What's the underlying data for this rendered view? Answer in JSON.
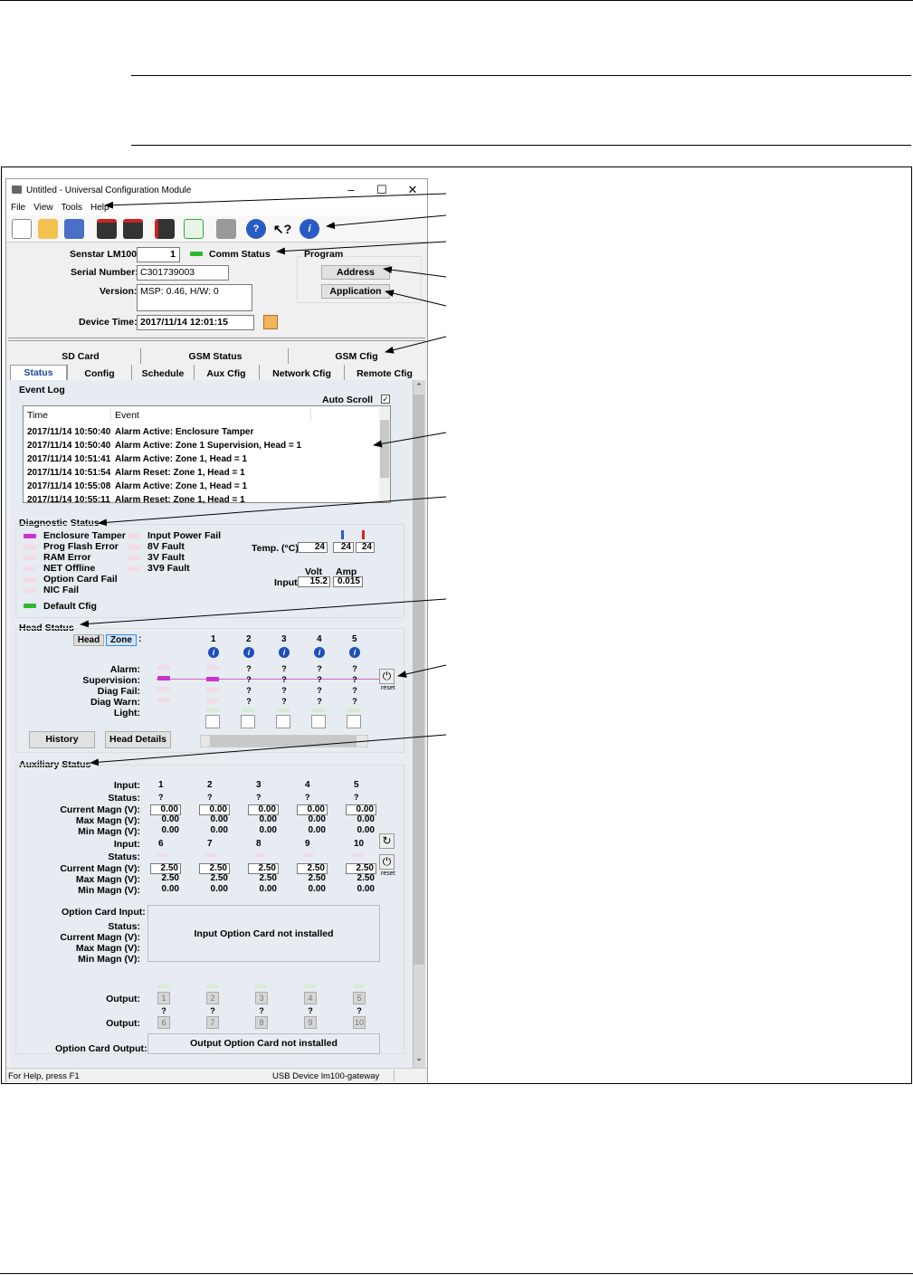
{
  "app": {
    "title": "Untitled - Universal Configuration Module",
    "window_controls": [
      "–",
      "☐",
      "✕"
    ],
    "menu": [
      "File",
      "View",
      "Tools",
      "Help"
    ]
  },
  "toolbar_icons": [
    "new-file-icon",
    "open-folder-icon",
    "save-icon",
    "download-icon",
    "upload-icon",
    "device-icon",
    "waveform-icon",
    "print-icon",
    "help-icon",
    "context-help-icon",
    "info-icon"
  ],
  "device": {
    "model_label": "Senstar LM100:",
    "model_value": "1",
    "comm_status": "Comm Status",
    "serial_label": "Serial Number:",
    "serial_value": "C301739003",
    "version_label": "Version:",
    "version_value": "MSP: 0.46, H/W: 0",
    "time_label": "Device Time:",
    "time_value": "2017/11/14 12:01:15"
  },
  "program": {
    "label": "Program",
    "address_button": "Address",
    "application_button": "Application"
  },
  "tabs_row1": [
    "SD Card",
    "GSM Status",
    "GSM Cfig"
  ],
  "tabs_row2": [
    "Status",
    "Config",
    "Schedule",
    "Aux Cfig",
    "Network Cfig",
    "Remote Cfig"
  ],
  "event_log": {
    "title": "Event Log",
    "auto_scroll": "Auto Scroll",
    "columns": [
      "Time",
      "Event"
    ],
    "rows": [
      [
        "2017/11/14 10:50:40",
        "Alarm Active: Enclosure Tamper"
      ],
      [
        "2017/11/14 10:50:40",
        "Alarm Active: Zone 1 Supervision, Head = 1"
      ],
      [
        "2017/11/14 10:51:41",
        "Alarm Active: Zone 1, Head = 1"
      ],
      [
        "2017/11/14 10:51:54",
        "Alarm Reset: Zone 1, Head = 1"
      ],
      [
        "2017/11/14 10:55:08",
        "Alarm Active: Zone 1, Head = 1"
      ],
      [
        "2017/11/14 10:55:11",
        "Alarm Reset: Zone 1, Head = 1"
      ]
    ]
  },
  "diagnostic": {
    "title": "Diagnostic Status",
    "left": [
      "Enclosure Tamper",
      "Prog Flash Error",
      "RAM Error",
      "NET Offline",
      "Option Card Fail",
      "NIC Fail"
    ],
    "right": [
      "Input Power Fail",
      "8V Fault",
      "3V Fault",
      "3V9 Fault"
    ],
    "default_cfig": "Default Cfig",
    "temp_label": "Temp. (°C):",
    "temp_values": [
      "24",
      "24",
      "24"
    ],
    "volt_label": "Volt",
    "amp_label": "Amp",
    "input_label": "Input:",
    "volt_value": "15.2",
    "amp_value": "0.015"
  },
  "head_status": {
    "title": "Head Status",
    "toggle": [
      "Head",
      "Zone"
    ],
    "colon": ":",
    "heads": [
      "1",
      "2",
      "3",
      "4",
      "5"
    ],
    "rows": [
      "Alarm:",
      "Supervision:",
      "Diag Fail:",
      "Diag Warn:",
      "Light:"
    ],
    "q": "?",
    "reset": "reset",
    "history_button": "History",
    "details_button": "Head Details"
  },
  "aux": {
    "title": "Auxiliary Status",
    "input_label": "Input:",
    "status_label": "Status:",
    "current_label": "Current Magn (V):",
    "max_label": "Max Magn (V):",
    "min_label": "Min Magn (V):",
    "inputs_a": [
      "1",
      "2",
      "3",
      "4",
      "5"
    ],
    "inputs_b": [
      "6",
      "7",
      "8",
      "9",
      "10"
    ],
    "a_current": [
      "0.00",
      "0.00",
      "0.00",
      "0.00",
      "0.00"
    ],
    "a_max": [
      "0.00",
      "0.00",
      "0.00",
      "0.00",
      "0.00"
    ],
    "a_min": [
      "0.00",
      "0.00",
      "0.00",
      "0.00",
      "0.00"
    ],
    "b_current": [
      "2.50",
      "2.50",
      "2.50",
      "2.50",
      "2.50"
    ],
    "b_max": [
      "2.50",
      "2.50",
      "2.50",
      "2.50",
      "2.50"
    ],
    "b_min": [
      "0.00",
      "0.00",
      "0.00",
      "0.00",
      "0.00"
    ],
    "option_card_input": "Option Card Input:",
    "input_not_installed": "Input Option Card not installed",
    "output_label": "Output:",
    "outputs_a": [
      "1",
      "2",
      "3",
      "4",
      "5"
    ],
    "outputs_b": [
      "6",
      "7",
      "8",
      "9",
      "10"
    ],
    "option_card_output": "Option Card Output:",
    "output_not_installed": "Output Option Card not installed",
    "reset": "reset"
  },
  "statusbar": {
    "help": "For Help, press F1",
    "device": "USB Device lm100-gateway"
  },
  "colors": {
    "accent": "#1e4fb8",
    "magenta": "#cc33cc",
    "green": "#2fb82f"
  }
}
